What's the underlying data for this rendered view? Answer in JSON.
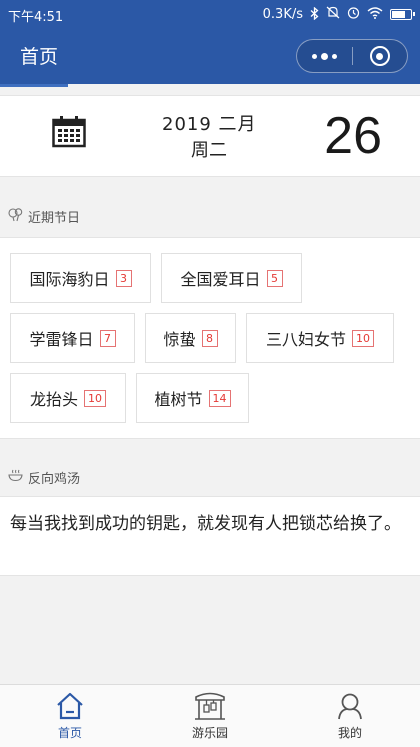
{
  "status": {
    "time": "下午4:51",
    "speed": "0.3K/s",
    "battery_level": 0.75
  },
  "nav": {
    "title": "首页"
  },
  "date": {
    "year_month": "2019 二月",
    "weekday": "周二",
    "day": "26"
  },
  "festivals": {
    "title": "近期节日",
    "items": [
      {
        "name": "国际海豹日",
        "days": "3"
      },
      {
        "name": "全国爱耳日",
        "days": "5"
      },
      {
        "name": "学雷锋日",
        "days": "7"
      },
      {
        "name": "惊蛰",
        "days": "8"
      },
      {
        "name": "三八妇女节",
        "days": "10"
      },
      {
        "name": "龙抬头",
        "days": "10"
      },
      {
        "name": "植树节",
        "days": "14"
      }
    ]
  },
  "quote": {
    "title": "反向鸡汤",
    "text": "每当我找到成功的钥匙，就发现有人把锁芯给换了。"
  },
  "tabbar": {
    "items": [
      {
        "label": "首页"
      },
      {
        "label": "游乐园"
      },
      {
        "label": "我的"
      }
    ]
  },
  "colors": {
    "brand": "#2b58a6",
    "badge": "#e53935"
  },
  "icons": [
    "bluetooth-icon",
    "mute-icon",
    "alarm-icon",
    "wifi-icon",
    "battery-icon",
    "more-icon",
    "target-icon",
    "calendar-icon",
    "festival-icon",
    "bowl-icon",
    "home-icon",
    "park-icon",
    "user-icon"
  ]
}
